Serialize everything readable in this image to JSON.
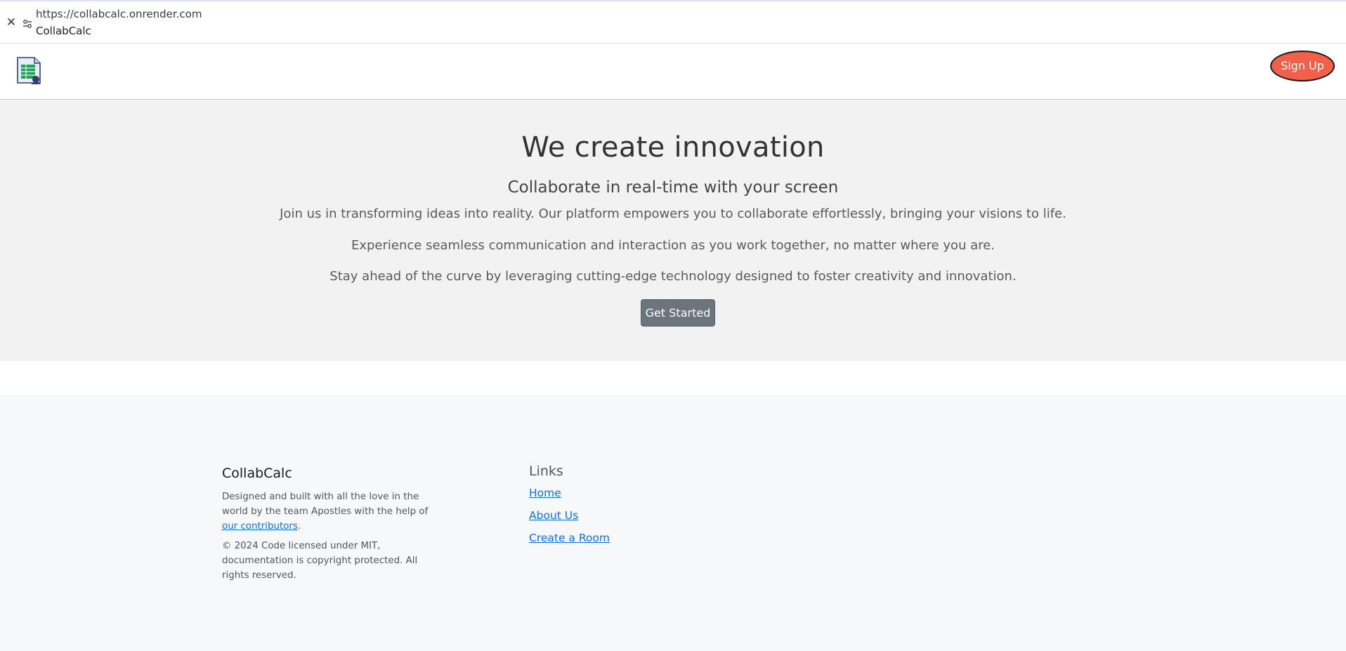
{
  "browser": {
    "url": "https://collabcalc.onrender.com",
    "title": "CollabCalc",
    "close_icon": "close-icon",
    "site_settings_icon": "tune-icon"
  },
  "header": {
    "logo_icon": "spreadsheet-logo-icon",
    "signup_label": "Sign Up",
    "signup_color": "#f0604a"
  },
  "hero": {
    "title": "We create innovation",
    "subtitle": "Collaborate in real-time with your screen",
    "paragraphs": [
      "Join us in transforming ideas into reality. Our platform empowers you to collaborate effortlessly, bringing your visions to life.",
      "Experience seamless communication and interaction as you work together, no matter where you are.",
      "Stay ahead of the curve by leveraging cutting-edge technology designed to foster creativity and innovation."
    ],
    "cta_label": "Get Started"
  },
  "footer": {
    "brand": "CollabCalc",
    "desc_prefix": "Designed and built with all the love in the world by the team Apostles with the help of ",
    "desc_link": "our contributors",
    "desc_suffix": ".",
    "copyright": "© 2024 Code licensed under MIT, documentation is copyright protected. All rights reserved.",
    "links_heading": "Links",
    "links": [
      "Home",
      "About Us",
      "Create a Room"
    ],
    "link_color": "#0d6efd"
  }
}
